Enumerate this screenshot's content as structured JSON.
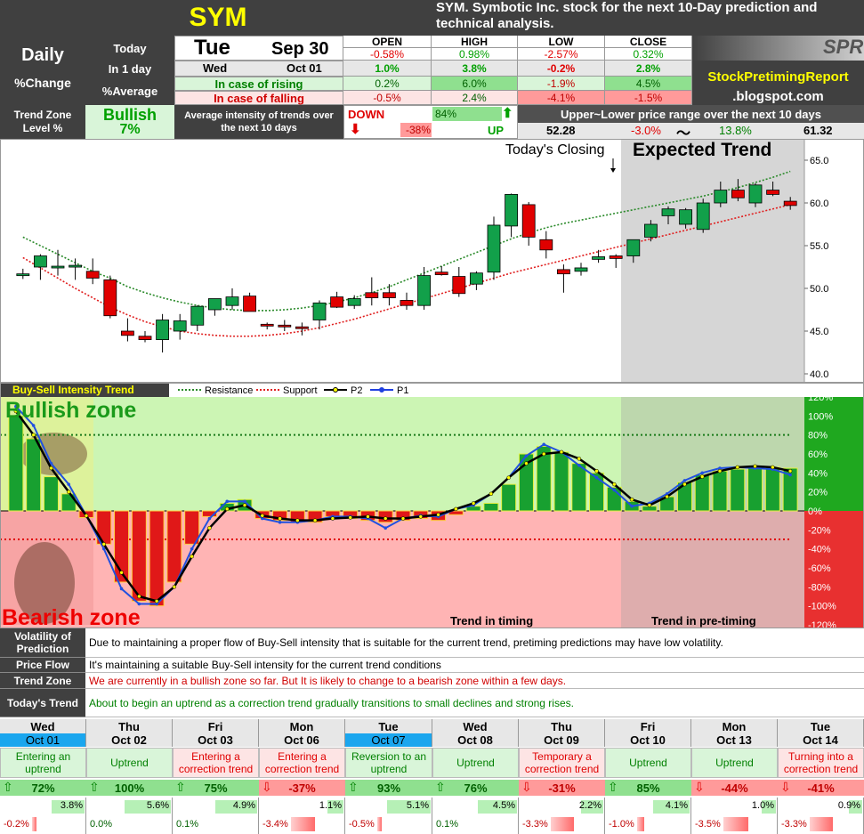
{
  "header": {
    "ticker": "SYM",
    "title": "SYM. Symbotic Inc. stock for the next 10-Day prediction and technical analysis.",
    "logo_text": "SPR",
    "blog_name": "StockPretimingReport",
    "blog_domain": ".blogspot.com"
  },
  "summary": {
    "daily": "Daily",
    "pct_change": "%Change",
    "today_lbl": "Today",
    "in1day_lbl": "In 1 day",
    "avg_lbl": "%Average",
    "today_dow": "Tue",
    "today_date": "Sep 30",
    "next_dow": "Wed",
    "next_date": "Oct 01",
    "rising_lbl": "In case of rising",
    "falling_lbl": "In case of falling",
    "cols": [
      "OPEN",
      "HIGH",
      "LOW",
      "CLOSE"
    ],
    "today_vals": [
      "-0.58%",
      "0.98%",
      "-2.57%",
      "0.32%"
    ],
    "in1day_vals": [
      "1.0%",
      "3.8%",
      "-0.2%",
      "2.8%"
    ],
    "rising_vals": [
      "0.2%",
      "6.0%",
      "-1.9%",
      "4.5%"
    ],
    "falling_vals": [
      "-0.5%",
      "2.4%",
      "-4.1%",
      "-1.5%"
    ]
  },
  "trend_zone": {
    "label": "Trend Zone Level %",
    "state": "Bullish",
    "value": "7%",
    "intensity_lbl": "Average intensity of trends over the next 10 days",
    "down_lbl": "DOWN",
    "down_val": "-38%",
    "up_val": "84%",
    "up_lbl": "UP",
    "range_title": "Upper~Lower price range over the next 10 days",
    "low_price": "52.28",
    "low_pct": "-3.0%",
    "tilde": "〜",
    "high_pct": "13.8%",
    "high_price": "61.32"
  },
  "chart_data": [
    {
      "type": "candlestick",
      "title": "",
      "annotations": [
        "Today's Closing",
        "Expected Trend"
      ],
      "ylim": [
        40,
        65
      ],
      "yticks": [
        "65.0",
        "60.0",
        "55.0",
        "50.0",
        "45.0",
        "40.0"
      ],
      "candles": [
        [
          51.7,
          52.3,
          51.1,
          51.7
        ],
        [
          52.5,
          54.0,
          51.0,
          53.8
        ],
        [
          52.6,
          54.5,
          51.5,
          52.6
        ],
        [
          52.6,
          53.5,
          51.0,
          52.7
        ],
        [
          52.0,
          53.5,
          50.5,
          51.2
        ],
        [
          51.0,
          51.5,
          46.5,
          46.8
        ],
        [
          45.0,
          46.5,
          43.8,
          44.5
        ],
        [
          44.4,
          45.0,
          43.7,
          44.0
        ],
        [
          44.0,
          47.0,
          42.5,
          46.3
        ],
        [
          45.0,
          47.0,
          44.0,
          46.2
        ],
        [
          45.7,
          48.0,
          45.0,
          47.9
        ],
        [
          47.5,
          48.8,
          46.8,
          48.8
        ],
        [
          48.0,
          50.0,
          47.5,
          49.0
        ],
        [
          49.1,
          49.5,
          47.5,
          47.3
        ],
        [
          45.8,
          46.0,
          45.2,
          45.6
        ],
        [
          45.7,
          46.3,
          45.0,
          45.5
        ],
        [
          45.5,
          46.0,
          44.5,
          45.4
        ],
        [
          46.3,
          48.6,
          45.2,
          48.3
        ],
        [
          49.0,
          49.6,
          47.7,
          47.8
        ],
        [
          48.0,
          49.2,
          47.6,
          48.8
        ],
        [
          49.5,
          51.3,
          48.0,
          48.9
        ],
        [
          49.5,
          50.5,
          48.0,
          48.9
        ],
        [
          48.6,
          49.5,
          47.5,
          48.0
        ],
        [
          48.0,
          52.5,
          47.5,
          51.5
        ],
        [
          51.9,
          52.6,
          51.5,
          51.6
        ],
        [
          51.4,
          52.5,
          49.0,
          49.4
        ],
        [
          50.5,
          52.0,
          49.8,
          51.8
        ],
        [
          51.9,
          58.4,
          51.0,
          57.4
        ],
        [
          57.3,
          61.1,
          56.0,
          61.0
        ],
        [
          59.8,
          60.1,
          55.0,
          56.0
        ],
        [
          55.7,
          56.7,
          53.5,
          54.5
        ],
        [
          52.2,
          52.8,
          49.5,
          51.7
        ],
        [
          52.0,
          53.0,
          51.5,
          52.4
        ],
        [
          53.4,
          54.5,
          53.0,
          53.7
        ],
        [
          53.8,
          54.0,
          52.4,
          53.5
        ],
        [
          53.8,
          55.7,
          53.0,
          55.7
        ],
        [
          56.0,
          58.0,
          55.5,
          57.5
        ],
        [
          58.5,
          59.6,
          57.5,
          59.3
        ],
        [
          57.5,
          59.4,
          57.0,
          59.2
        ],
        [
          56.9,
          60.5,
          56.5,
          60.0
        ],
        [
          60.0,
          62.5,
          59.5,
          61.5
        ],
        [
          61.5,
          62.8,
          60.2,
          60.6
        ],
        [
          60.0,
          62.3,
          59.5,
          62.1
        ],
        [
          61.5,
          62.5,
          60.8,
          61.0
        ],
        [
          60.2,
          60.7,
          59.2,
          59.7
        ]
      ],
      "resistance": [
        56.0,
        55.0,
        54.0,
        53.0,
        52.0,
        51.2,
        50.2,
        49.5,
        48.9,
        48.4,
        48.0,
        47.7,
        47.5,
        47.4,
        47.4,
        47.5,
        47.7,
        48.0,
        48.4,
        48.9,
        49.5,
        50.2,
        51.0,
        51.8,
        52.6,
        53.4,
        54.2,
        55.0,
        55.8,
        56.5,
        57.1,
        57.6,
        58.0,
        58.4,
        58.8,
        59.2,
        59.6,
        60.0,
        60.4,
        60.8,
        61.3,
        61.8,
        62.4,
        63.0,
        63.7
      ],
      "support": [
        53.6,
        52.4,
        51.2,
        50.0,
        48.9,
        47.8,
        46.9,
        46.1,
        45.5,
        45.0,
        44.7,
        44.5,
        44.4,
        44.4,
        44.5,
        44.7,
        45.0,
        45.4,
        45.9,
        46.4,
        47.0,
        47.6,
        48.2,
        48.8,
        49.4,
        50.0,
        50.6,
        51.2,
        51.8,
        52.3,
        52.8,
        53.3,
        53.8,
        54.3,
        54.8,
        55.3,
        55.8,
        56.3,
        56.8,
        57.3,
        57.8,
        58.3,
        58.8,
        59.3,
        59.8
      ]
    },
    {
      "type": "bar+line",
      "title": "Buy-Sell Intensity Trend",
      "legend": [
        "Resistance",
        "Support",
        "P2",
        "P1"
      ],
      "zones": [
        "Bullish zone",
        "Bearish zone"
      ],
      "captions": [
        "Trend in timing",
        "Trend in pre-timing"
      ],
      "ylim": [
        -120,
        120
      ],
      "yticks": [
        "120%",
        "100%",
        "80%",
        "60%",
        "40%",
        "20%",
        "0%",
        "-20%",
        "-40%",
        "-60%",
        "-80%",
        "-100%",
        "-120%"
      ],
      "resistance_level": 80,
      "support_level": -30,
      "bars": [
        100,
        76,
        36,
        18,
        -7,
        -35,
        -75,
        -95,
        -100,
        -75,
        -35,
        -6,
        8,
        12,
        -8,
        -10,
        -12,
        -12,
        -6,
        -8,
        -10,
        -12,
        -10,
        -8,
        -10,
        -4,
        5,
        8,
        28,
        60,
        68,
        62,
        50,
        40,
        25,
        10,
        5,
        15,
        30,
        38,
        42,
        44,
        45,
        46,
        45
      ],
      "p1": [
        110,
        90,
        50,
        28,
        -5,
        -40,
        -82,
        -98,
        -98,
        -80,
        -40,
        -8,
        10,
        10,
        -8,
        -12,
        -12,
        -10,
        -6,
        -6,
        -8,
        -18,
        -8,
        -5,
        -6,
        2,
        6,
        18,
        35,
        58,
        70,
        62,
        48,
        35,
        22,
        5,
        8,
        18,
        32,
        40,
        45,
        46,
        45,
        44,
        38
      ],
      "p2": [
        105,
        80,
        45,
        20,
        -5,
        -35,
        -65,
        -90,
        -95,
        -80,
        -48,
        -18,
        2,
        6,
        -5,
        -8,
        -10,
        -10,
        -8,
        -7,
        -6,
        -8,
        -8,
        -6,
        -4,
        2,
        8,
        18,
        35,
        50,
        60,
        62,
        55,
        42,
        28,
        12,
        6,
        15,
        28,
        36,
        42,
        46,
        47,
        46,
        42
      ]
    }
  ],
  "info": {
    "rows": [
      {
        "lbl": "Volatility of Prediction",
        "txt": "Due to maintaining a proper flow of Buy-Sell intensity that is suitable for the current trend, pretiming predictions may have low volatility.",
        "color": "#000000"
      },
      {
        "lbl": "Price Flow",
        "txt": "It's maintaining a suitable Buy-Sell intensity for the current trend conditions",
        "color": "#000000"
      },
      {
        "lbl": "Trend Zone",
        "txt": "We are currently in a bullish zone so far. But It is likely to change to a bearish zone within a few days.",
        "color": "#d00000"
      },
      {
        "lbl": "Today's Trend",
        "txt": "About to begin an uptrend as a correction trend gradually transitions to small declines and strong rises.",
        "color": "#008000"
      }
    ]
  },
  "forecast": [
    {
      "dow": "Wed",
      "date": "Oct 01",
      "hl": true,
      "desc": "Entering an uptrend",
      "red": false,
      "arrow": "⇧",
      "pct": "72%",
      "up": "3.8%",
      "up_frac": 0.3,
      "down": "-0.2%",
      "down_frac": 0.05
    },
    {
      "dow": "Thu",
      "date": "Oct 02",
      "hl": false,
      "desc": "Uptrend",
      "red": false,
      "arrow": "⇧",
      "pct": "100%",
      "up": "5.6%",
      "up_frac": 0.45,
      "down": "0.0%",
      "down_frac": 0.0
    },
    {
      "dow": "Fri",
      "date": "Oct 03",
      "hl": false,
      "desc": "Entering a correction trend",
      "red": true,
      "arrow": "⇧",
      "pct": "75%",
      "up": "4.9%",
      "up_frac": 0.4,
      "down": "0.1%",
      "down_frac": 0.0
    },
    {
      "dow": "Mon",
      "date": "Oct 06",
      "hl": false,
      "desc": "Entering a correction trend",
      "red": true,
      "arrow": "⇩",
      "pct": "-37%",
      "up": "1.1%",
      "up_frac": 0.1,
      "down": "-3.4%",
      "down_frac": 0.28
    },
    {
      "dow": "Tue",
      "date": "Oct 07",
      "hl": true,
      "desc": "Reversion to an uptrend",
      "red": false,
      "arrow": "⇧",
      "pct": "93%",
      "up": "5.1%",
      "up_frac": 0.42,
      "down": "-0.5%",
      "down_frac": 0.05
    },
    {
      "dow": "Wed",
      "date": "Oct 08",
      "hl": false,
      "desc": "Uptrend",
      "red": false,
      "arrow": "⇧",
      "pct": "76%",
      "up": "4.5%",
      "up_frac": 0.37,
      "down": "0.1%",
      "down_frac": 0.0
    },
    {
      "dow": "Thu",
      "date": "Oct 09",
      "hl": false,
      "desc": "Temporary a correction trend",
      "red": true,
      "arrow": "⇩",
      "pct": "-31%",
      "up": "2.2%",
      "up_frac": 0.18,
      "down": "-3.3%",
      "down_frac": 0.27
    },
    {
      "dow": "Fri",
      "date": "Oct 10",
      "hl": false,
      "desc": "Uptrend",
      "red": false,
      "arrow": "⇧",
      "pct": "85%",
      "up": "4.1%",
      "up_frac": 0.34,
      "down": "-1.0%",
      "down_frac": 0.08
    },
    {
      "dow": "Mon",
      "date": "Oct 13",
      "hl": false,
      "desc": "Uptrend",
      "red": false,
      "arrow": "⇩",
      "pct": "-44%",
      "up": "1.0%",
      "up_frac": 0.08,
      "down": "-3.5%",
      "down_frac": 0.29
    },
    {
      "dow": "Tue",
      "date": "Oct 14",
      "hl": false,
      "desc": "Turning into a correction trend",
      "red": true,
      "arrow": "⇩",
      "pct": "-41%",
      "up": "0.9%",
      "up_frac": 0.07,
      "down": "-3.3%",
      "down_frac": 0.27
    }
  ]
}
